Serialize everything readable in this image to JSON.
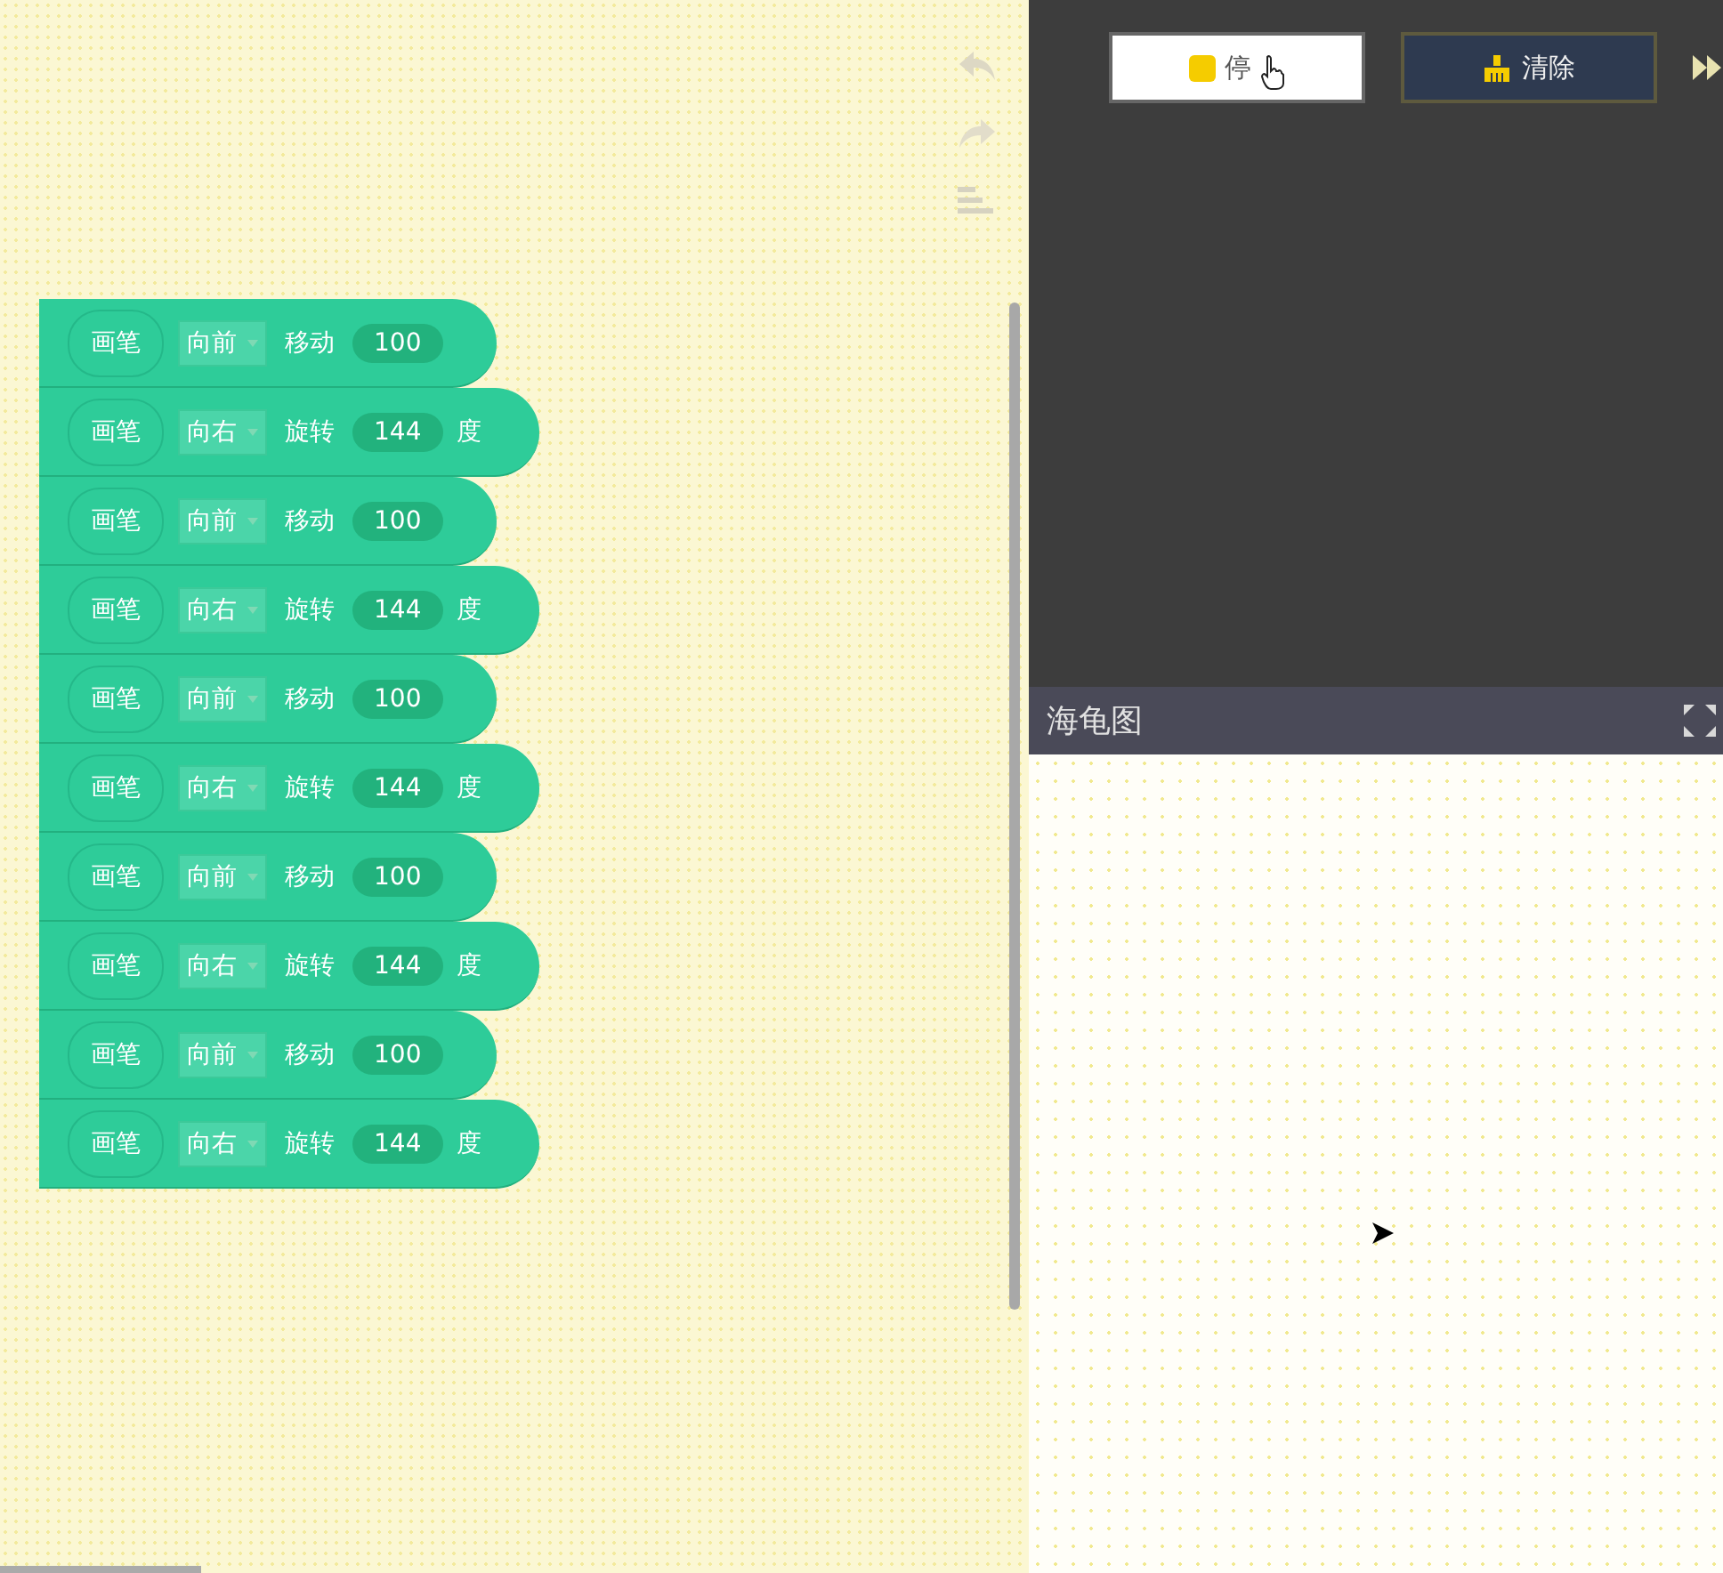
{
  "workspace": {
    "blocks": [
      {
        "kind": "move",
        "pen": "画笔",
        "direction": "向前",
        "action": "移动",
        "value": "100"
      },
      {
        "kind": "turn",
        "pen": "画笔",
        "direction": "向右",
        "action": "旋转",
        "value": "144",
        "unit": "度"
      },
      {
        "kind": "move",
        "pen": "画笔",
        "direction": "向前",
        "action": "移动",
        "value": "100"
      },
      {
        "kind": "turn",
        "pen": "画笔",
        "direction": "向右",
        "action": "旋转",
        "value": "144",
        "unit": "度"
      },
      {
        "kind": "move",
        "pen": "画笔",
        "direction": "向前",
        "action": "移动",
        "value": "100"
      },
      {
        "kind": "turn",
        "pen": "画笔",
        "direction": "向右",
        "action": "旋转",
        "value": "144",
        "unit": "度"
      },
      {
        "kind": "move",
        "pen": "画笔",
        "direction": "向前",
        "action": "移动",
        "value": "100"
      },
      {
        "kind": "turn",
        "pen": "画笔",
        "direction": "向右",
        "action": "旋转",
        "value": "144",
        "unit": "度"
      },
      {
        "kind": "move",
        "pen": "画笔",
        "direction": "向前",
        "action": "移动",
        "value": "100"
      },
      {
        "kind": "turn",
        "pen": "画笔",
        "direction": "向右",
        "action": "旋转",
        "value": "144",
        "unit": "度"
      }
    ]
  },
  "controls": {
    "stop": "停",
    "clear": "清除"
  },
  "stage": {
    "title": "海龟图"
  }
}
